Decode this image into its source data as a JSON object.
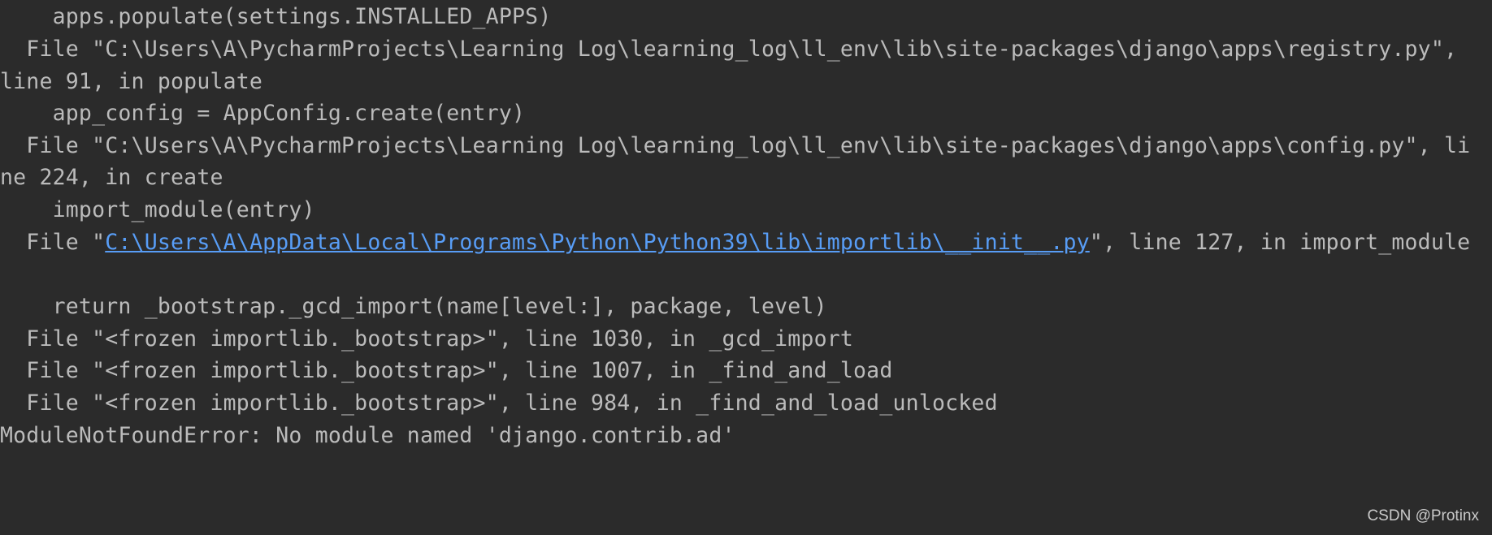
{
  "console": {
    "lines": [
      "    apps.populate(settings.INSTALLED_APPS)",
      "  File \"C:\\Users\\A\\PycharmProjects\\Learning Log\\learning_log\\ll_env\\lib\\site-packages\\django\\apps\\registry.py\",",
      "line 91, in populate",
      "    app_config = AppConfig.create(entry)",
      "  File \"C:\\Users\\A\\PycharmProjects\\Learning Log\\learning_log\\ll_env\\lib\\site-packages\\django\\apps\\config.py\", li",
      "ne 224, in create",
      "    import_module(entry)",
      {
        "prefix": "  File \"",
        "link": "C:\\Users\\A\\AppData\\Local\\Programs\\Python\\Python39\\lib\\importlib\\__init__.py",
        "suffix": "\", line 127, in import_module"
      },
      "",
      "    return _bootstrap._gcd_import(name[level:], package, level)",
      "  File \"<frozen importlib._bootstrap>\", line 1030, in _gcd_import",
      "  File \"<frozen importlib._bootstrap>\", line 1007, in _find_and_load",
      "  File \"<frozen importlib._bootstrap>\", line 984, in _find_and_load_unlocked",
      "ModuleNotFoundError: No module named 'django.contrib.ad'"
    ]
  },
  "watermark": "CSDN @Protinx",
  "colors": {
    "background": "#2b2b2b",
    "text": "#bbbbbb",
    "link": "#589df6"
  }
}
